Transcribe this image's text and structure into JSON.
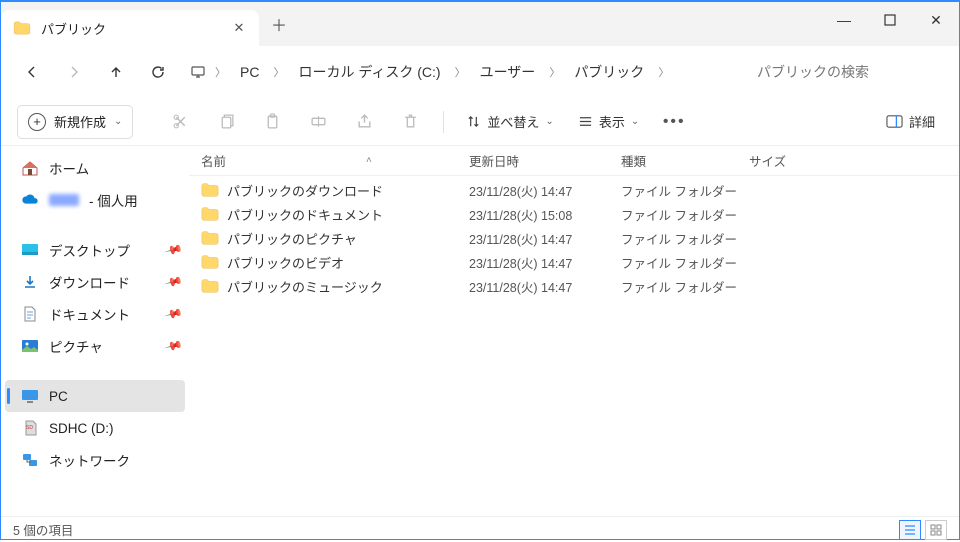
{
  "window": {
    "tab_title": "パブリック",
    "new_label": "新規作成",
    "sort_label": "並べ替え",
    "view_label": "表示",
    "details_label": "詳細",
    "search_placeholder": "パブリックの検索",
    "status_text": "5 個の項目"
  },
  "breadcrumb": {
    "segs": [
      "PC",
      "ローカル ディスク (C:)",
      "ユーザー",
      "パブリック"
    ]
  },
  "columns": {
    "name": "名前",
    "date": "更新日時",
    "type": "種類",
    "size": "サイズ"
  },
  "sidebar": {
    "home": "ホーム",
    "personal_suffix": " - 個人用",
    "desktop": "デスクトップ",
    "downloads": "ダウンロード",
    "documents": "ドキュメント",
    "pictures": "ピクチャ",
    "pc": "PC",
    "sdhc": "SDHC (D:)",
    "network": "ネットワーク"
  },
  "rows": [
    {
      "name": "パブリックのダウンロード",
      "date": "23/11/28(火) 14:47",
      "type": "ファイル フォルダー"
    },
    {
      "name": "パブリックのドキュメント",
      "date": "23/11/28(火) 15:08",
      "type": "ファイル フォルダー"
    },
    {
      "name": "パブリックのピクチャ",
      "date": "23/11/28(火) 14:47",
      "type": "ファイル フォルダー"
    },
    {
      "name": "パブリックのビデオ",
      "date": "23/11/28(火) 14:47",
      "type": "ファイル フォルダー"
    },
    {
      "name": "パブリックのミュージック",
      "date": "23/11/28(火) 14:47",
      "type": "ファイル フォルダー"
    }
  ]
}
